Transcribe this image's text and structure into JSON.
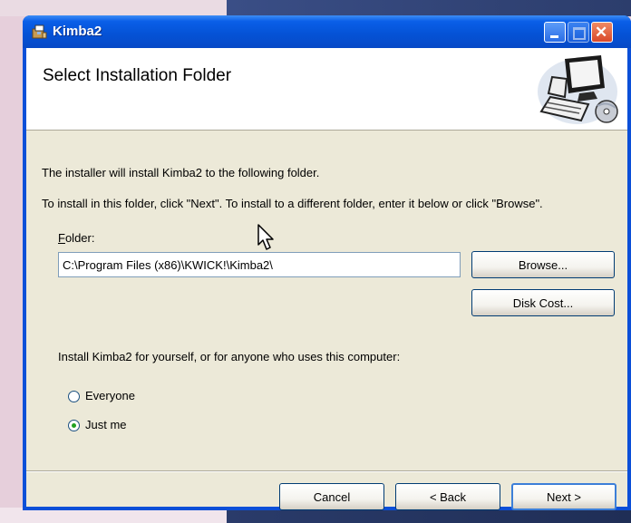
{
  "window": {
    "title": "Kimba2"
  },
  "banner": {
    "title": "Select Installation Folder"
  },
  "body": {
    "intro": "The installer will install Kimba2 to the following folder.",
    "instructions": "To install in this folder, click \"Next\". To install to a different folder, enter it below or click \"Browse\".",
    "folder_label_first": "F",
    "folder_label_rest": "older:",
    "folder_value": "C:\\Program Files (x86)\\KWICK!\\Kimba2\\",
    "browse_label": "Browse...",
    "disk_cost_label": "Disk Cost...",
    "install_for_text": "Install Kimba2 for yourself, or for anyone who uses this computer:",
    "option_everyone": "Everyone",
    "option_just_me": "Just me",
    "selected_option": "Just me"
  },
  "footer": {
    "cancel_label": "Cancel",
    "back_label": "< Back",
    "next_label": "Next >"
  },
  "icons": {
    "app": "installer-package-icon",
    "banner": "computer-with-cd-icon",
    "pointer": "mouse-cursor-icon"
  },
  "colors": {
    "titlebar": "#0553d7",
    "dialog_background": "#ece9d8",
    "banner_background": "#ffffff",
    "close_button": "#d9482a"
  }
}
